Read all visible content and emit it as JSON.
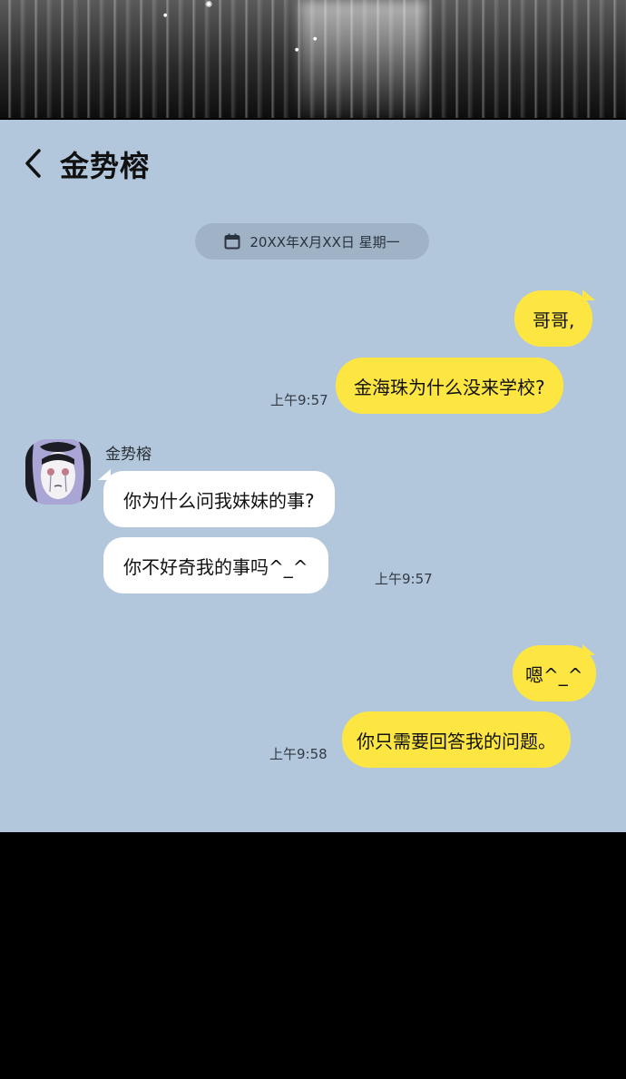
{
  "chat": {
    "title": "金势榕",
    "date": "20XX年X月XX日 星期一"
  },
  "messages": {
    "m1": "哥哥,",
    "m2": "金海珠为什么没来学校?",
    "t1": "上午9:57",
    "sender": "金势榕",
    "m3": "你为什么问我妹妹的事?",
    "m4": "你不好奇我的事吗^_^",
    "t2": "上午9:57",
    "m5": "嗯^_^",
    "m6": "你只需要回答我的问题。",
    "t3": "上午9:58"
  },
  "colors": {
    "chat_bg": "#b2c7dc",
    "outgoing_bubble": "#fde642",
    "incoming_bubble": "#ffffff",
    "date_pill": "#9fb2c6"
  },
  "icons": {
    "back": "chevron-left-icon",
    "calendar": "calendar-icon"
  }
}
